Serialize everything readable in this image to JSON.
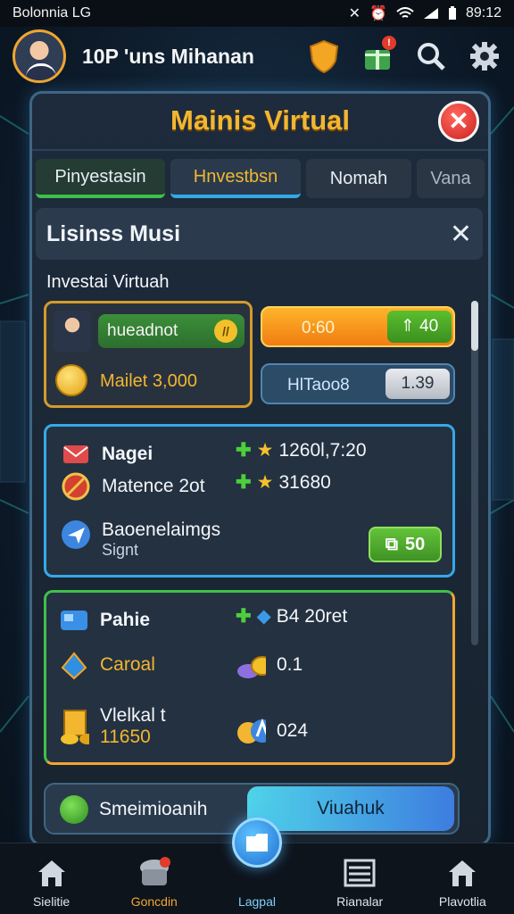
{
  "status_bar": {
    "left_text": "Bolonnia  LG",
    "time": "89:12"
  },
  "header": {
    "username": "10P 'uns Mihanan",
    "icons": [
      "shield-icon",
      "gift-icon",
      "search-icon",
      "gear-icon"
    ],
    "gift_badge": "!"
  },
  "panel": {
    "title": "Mainis Virtual",
    "close_symbol": "✕",
    "tabs": [
      {
        "label": "Pinyestasin"
      },
      {
        "label": "Hnvestbsn"
      },
      {
        "label": "Nomah"
      },
      {
        "label": "Vana"
      }
    ]
  },
  "dialog": {
    "title": "Lisinss Musi",
    "close_symbol": "✕"
  },
  "section_label": "Investai Virtuah",
  "investment_card": {
    "pill_label": "hueadnot",
    "pill_badge": "//",
    "coin_text": "Mailet 3,000"
  },
  "progress": {
    "text": "0:60",
    "tag": "⇑ 40",
    "fill_fraction": 1.0
  },
  "hp": {
    "text": "HlTaoo8",
    "tag": "1.39"
  },
  "stats_card": {
    "rows": [
      {
        "label": "Nagei",
        "value": "1260l,7:20"
      },
      {
        "label": "Matence 2ot",
        "value": "31680"
      }
    ],
    "action_title": "Baoenelaimgs",
    "action_subtitle": "Signt",
    "action_button": "50"
  },
  "resources_card": {
    "title": "Pahie",
    "title_value": "B4 20ret",
    "rows": [
      {
        "label": "Caroal",
        "value": "0.1"
      }
    ],
    "bottom_label": "Vlelkal t",
    "bottom_sub": "11650",
    "bottom_value": "024"
  },
  "bottom_action": {
    "label": "Smeimioanih",
    "button": "Viuahuk"
  },
  "nav": {
    "items": [
      {
        "label": "Sielitie"
      },
      {
        "label": "Goncdin"
      },
      {
        "label": "Lagpal"
      },
      {
        "label": "Rianalar"
      },
      {
        "label": "Plavotlia"
      }
    ]
  },
  "colors": {
    "accent_gold": "#f2b631",
    "accent_blue": "#35a9e8",
    "accent_green": "#3fc04b",
    "danger": "#cc1f1f"
  }
}
